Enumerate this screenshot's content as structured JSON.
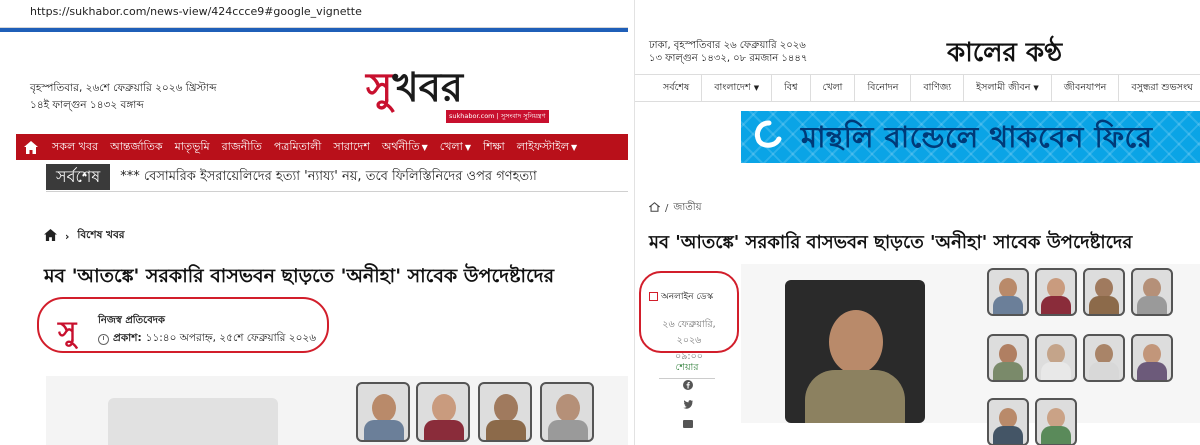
{
  "left": {
    "url": "https://sukhabor.com/news-view/424ccce9#google_vignette",
    "date_line1": "বৃহস্পতিবার, ২৬শে ফেব্রুয়ারি ২০২৬ খ্রিস্টাব্দ",
    "date_line2": "১৪ই ফাল্গুন ১৪৩২ বঙ্গাব্দ",
    "logo_part1": "সু",
    "logo_part2": "খবর",
    "logo_tagline": "sukhabor.com | সুসংবাদ সুনিয়ন্ত্রণ",
    "nav_items": [
      "সকল খবর",
      "আন্তর্জাতিক",
      "মাতৃভূমি",
      "রাজনীতি",
      "পত্রমিতালী",
      "সারাদেশ",
      "অর্থনীতি",
      "খেলা",
      "শিক্ষা",
      "লাইফস্টাইল"
    ],
    "ticker_label": "সর্বশেষ",
    "ticker_text": "*** বেসামরিক ইসরায়েলিদের হত্যা 'ন্যায্য' নয়, তবে ফিলিস্তিনিদের ওপর গণহত্যা",
    "breadcrumb": "বিশেষ খবর",
    "headline": "মব 'আতঙ্কে' সরকারি বাসভবন ছাড়তে 'অনীহা' সাবেক উপদেষ্টাদের",
    "author_logo": "সু",
    "author": "নিজস্ব প্রতিবেদক",
    "published_label": "প্রকাশ:",
    "published_time": "১১:৪০ অপরাহ্ন, ২৫শে ফেব্রুয়ারি ২০২৬"
  },
  "right": {
    "date_line1": "ঢাকা, বৃহস্পতিবার ২৬ ফেব্রুয়ারি ২০২৬",
    "date_line2": "১৩ ফাল্গুন ১৪৩২, ০৮ রমজান ১৪৪৭",
    "logo": "কালের কণ্ঠ",
    "nav_items": [
      "সর্বশেষ",
      "বাংলাদেশ",
      "বিশ্ব",
      "খেলা",
      "বিনোদন",
      "বাণিজ্য",
      "ইসলামী জীবন",
      "জীবনযাপন",
      "বসুন্ধরা শুভসংঘ"
    ],
    "banner_text": "মান্থলি বান্ডেলে থাকবেন ফিরে",
    "breadcrumb": "জাতীয়",
    "headline": "মব 'আতঙ্কে' সরকারি বাসভবন ছাড়তে 'অনীহা' সাবেক উপদেষ্টাদের",
    "desk": "অনলাইন ডেস্ক",
    "date": "২৬ ফেব্রুয়ারি, ২০২৬",
    "time": "০৯:০০",
    "share_label": "শেয়ার"
  },
  "colors": {
    "sukhabor_red": "#c8102e",
    "nav_red": "#b9101a",
    "circle_red": "#d21e2b",
    "banner_blue": "#0aa4e6"
  }
}
